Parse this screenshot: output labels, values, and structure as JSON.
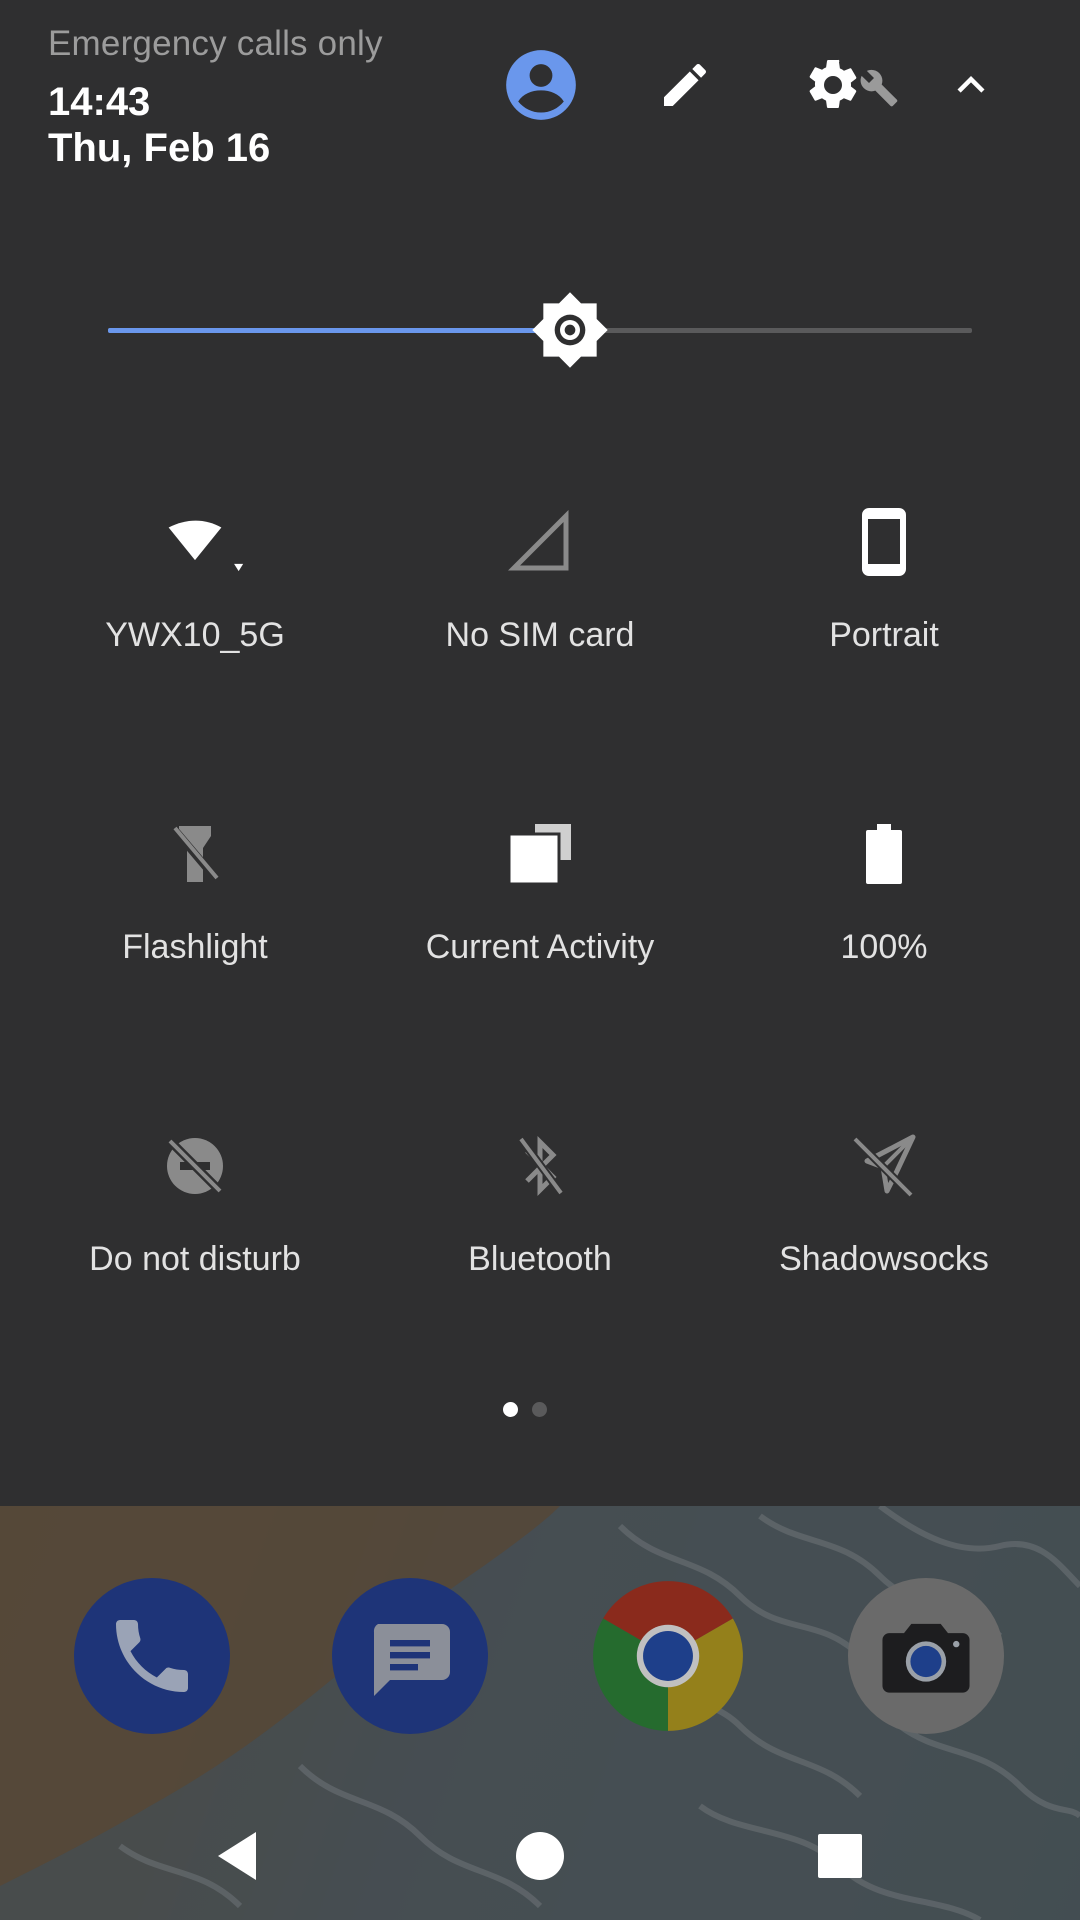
{
  "status": {
    "carrier": "Emergency calls only",
    "time": "14:43",
    "date": "Thu, Feb 16"
  },
  "header": {
    "user_icon": "account-circle-icon",
    "edit_icon": "pencil-icon",
    "settings_icon": "gear-icon",
    "collapse_icon": "chevron-up-icon"
  },
  "brightness": {
    "level": 0.535,
    "accent": "#6a97ec"
  },
  "tiles": [
    {
      "label": "YWX10_5G",
      "icon": "wifi-icon",
      "active": true
    },
    {
      "label": "No SIM card",
      "icon": "signal-icon",
      "active": false
    },
    {
      "label": "Portrait",
      "icon": "phone-portrait-icon",
      "active": true
    },
    {
      "label": "Flashlight",
      "icon": "flashlight-off-icon",
      "active": false
    },
    {
      "label": "Current Activity",
      "icon": "window-icon",
      "active": true
    },
    {
      "label": "100%",
      "icon": "battery-icon",
      "active": true
    },
    {
      "label": "Do not disturb",
      "icon": "dnd-off-icon",
      "active": false
    },
    {
      "label": "Bluetooth",
      "icon": "bluetooth-off-icon",
      "active": false
    },
    {
      "label": "Shadowsocks",
      "icon": "paper-plane-off-icon",
      "active": false
    }
  ],
  "pages": {
    "count": 2,
    "current": 1
  },
  "dock": [
    {
      "name": "Phone",
      "icon": "phone-icon"
    },
    {
      "name": "Messages",
      "icon": "messages-icon"
    },
    {
      "name": "Chrome",
      "icon": "chrome-icon"
    },
    {
      "name": "Camera",
      "icon": "camera-icon"
    }
  ],
  "navbar": [
    "back-icon",
    "home-icon",
    "recents-icon"
  ]
}
